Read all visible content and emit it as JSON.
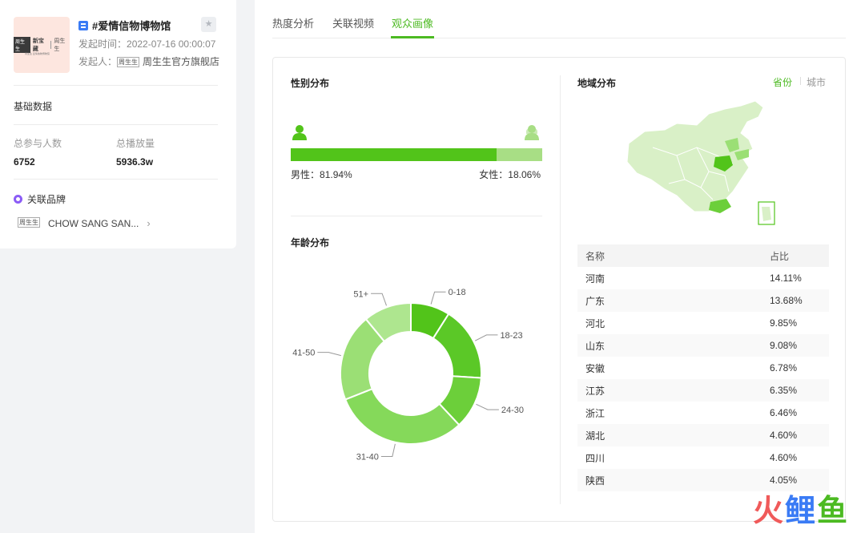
{
  "topic": {
    "title": "#爱情信物博物馆",
    "time_label": "发起时间：",
    "time_value": "2022-07-16 00:00:07",
    "owner_label": "发起人：",
    "owner_name": "周生生官方旗舰店",
    "cover_logo": {
      "box": "周生生",
      "text": "新宝藏",
      "brand": "周生生",
      "sub": "周生生 爱情信物博物馆"
    }
  },
  "basic": {
    "title": "基础数据",
    "participants_label": "总参与人数",
    "participants_value": "6752",
    "plays_label": "总播放量",
    "plays_value": "5936.3w"
  },
  "brand": {
    "title": "关联品牌",
    "name": "CHOW SANG SAN...",
    "logo_text": "周生生"
  },
  "tabs": [
    {
      "label": "热度分析",
      "active": false
    },
    {
      "label": "关联视频",
      "active": false
    },
    {
      "label": "观众画像",
      "active": true
    }
  ],
  "gender": {
    "title": "性别分布",
    "male_label": "男性：",
    "male_pct": 81.94,
    "male_text": "81.94%",
    "female_label": "女性：",
    "female_pct": 18.06,
    "female_text": "18.06%",
    "male_color": "#52c41a",
    "female_color": "#a8de85"
  },
  "age": {
    "title": "年龄分布"
  },
  "chart_data": {
    "type": "pie",
    "title": "年龄分布",
    "categories": [
      "0-18",
      "18-23",
      "24-30",
      "31-40",
      "41-50",
      "51+"
    ],
    "values": [
      9,
      17,
      12,
      31,
      20,
      11
    ],
    "colors": [
      "#52c41a",
      "#5bc827",
      "#6ccf3a",
      "#85d95a",
      "#9bdf75",
      "#aee68f"
    ],
    "donut": true
  },
  "region": {
    "title": "地域分布",
    "toggle_province": "省份",
    "toggle_city": "城市",
    "columns": [
      "名称",
      "占比"
    ],
    "rows": [
      {
        "name": "河南",
        "pct": "14.11%"
      },
      {
        "name": "广东",
        "pct": "13.68%"
      },
      {
        "name": "河北",
        "pct": "9.85%"
      },
      {
        "name": "山东",
        "pct": "9.08%"
      },
      {
        "name": "安徽",
        "pct": "6.78%"
      },
      {
        "name": "江苏",
        "pct": "6.35%"
      },
      {
        "name": "浙江",
        "pct": "6.46%"
      },
      {
        "name": "湖北",
        "pct": "4.60%"
      },
      {
        "name": "四川",
        "pct": "4.60%"
      },
      {
        "name": "陕西",
        "pct": "4.05%"
      }
    ]
  },
  "watermark": {
    "chars": [
      "火",
      "鲤",
      "鱼"
    ],
    "colors": [
      "#f05a5a",
      "#3a7bf5",
      "#4cba22"
    ]
  }
}
